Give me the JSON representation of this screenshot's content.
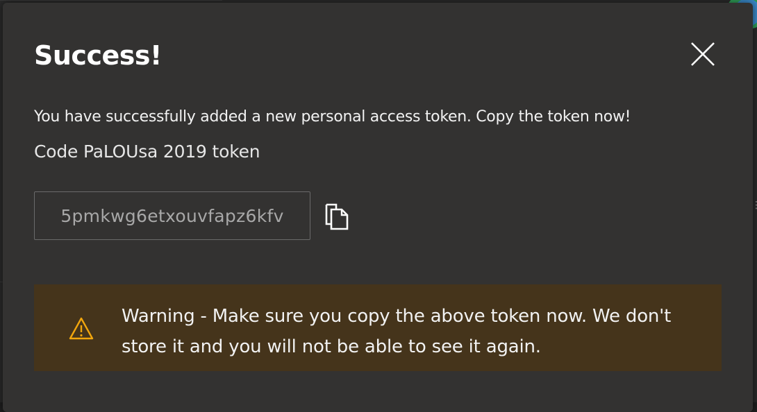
{
  "dialog": {
    "title": "Success!",
    "description": "You have successfully added a new personal access token. Copy the token now!",
    "token_name": "Code PaLOUsa 2019 token",
    "token_value": "5pmkwg6etxouvfapz6kfv",
    "close_icon": "close-icon",
    "copy_icon": "copy-icon",
    "warning": {
      "icon": "warning-icon",
      "text": "Warning - Make sure you copy the above token now. We don't store it and you will not be able to see it again."
    }
  },
  "colors": {
    "dialog_background": "#333231",
    "warning_background": "#45341b",
    "warning_icon": "#f2a60d",
    "text_primary": "#ffffff",
    "token_text": "#a8a8a8",
    "input_border": "#6b6b6b"
  }
}
